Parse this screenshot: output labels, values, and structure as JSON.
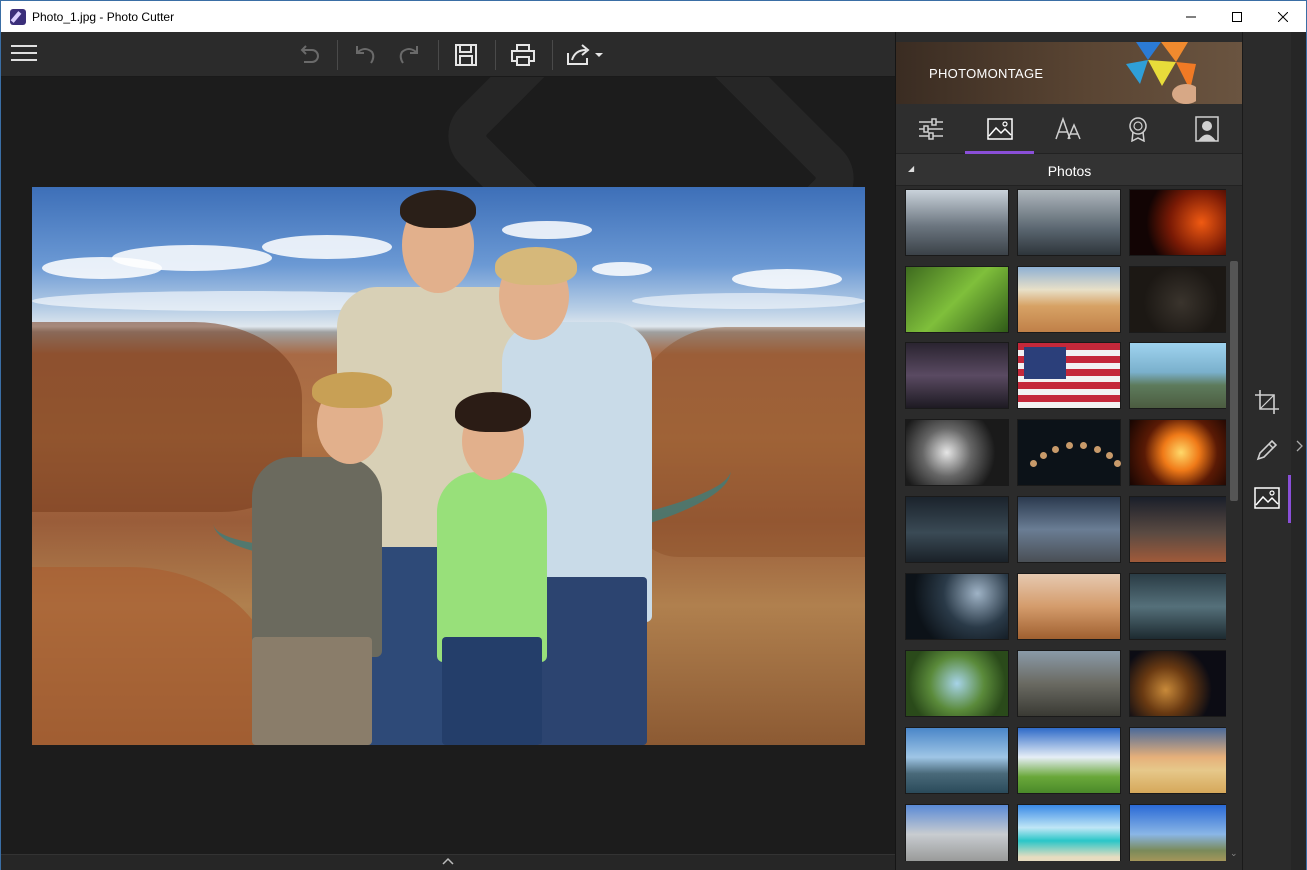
{
  "window": {
    "title": "Photo_1.jpg - Photo Cutter",
    "controls": [
      "minimize",
      "maximize",
      "close"
    ]
  },
  "toolbar": {
    "items": [
      "menu-icon",
      "undo-all-icon",
      "undo-icon",
      "redo-icon",
      "save-icon",
      "print-icon",
      "share-icon"
    ]
  },
  "panel": {
    "banner_text": "PHOTOMONTAGE",
    "tabs": [
      "adjustments-icon",
      "backgrounds-icon",
      "text-icon",
      "badge-icon",
      "portrait-icon"
    ],
    "active_tab": 1,
    "section_title": "Photos",
    "thumbnails": [
      [
        "misty-castle",
        "stormy-shore",
        "burning-guitar"
      ],
      [
        "green-moss",
        "desert-dunes",
        "gorilla-cave"
      ],
      [
        "lightning-storm",
        "american-flag",
        "hollywood-sign"
      ],
      [
        "eagle-bw",
        "lunar-phases",
        "fire-explosion"
      ],
      [
        "moonlit-ocean",
        "planet-landscape",
        "space-bridge"
      ],
      [
        "dark-forest",
        "elephant-savanna",
        "sunken-plane"
      ],
      [
        "pterodactyl-flight",
        "polar-bear-rocks",
        "roaring-lion"
      ],
      [
        "brooklyn-bridge",
        "eiffel-tower",
        "pyramids"
      ],
      [
        "mount-rushmore",
        "tropical-beach",
        "mountain-valley"
      ]
    ]
  },
  "rail": {
    "items": [
      "crop-icon",
      "pencil-icon",
      "background-icon"
    ],
    "active": 2
  },
  "colors": {
    "accent": "#8a4fd8",
    "panel_bg": "#2b2b2b",
    "canvas_bg": "#1c1c1c"
  }
}
